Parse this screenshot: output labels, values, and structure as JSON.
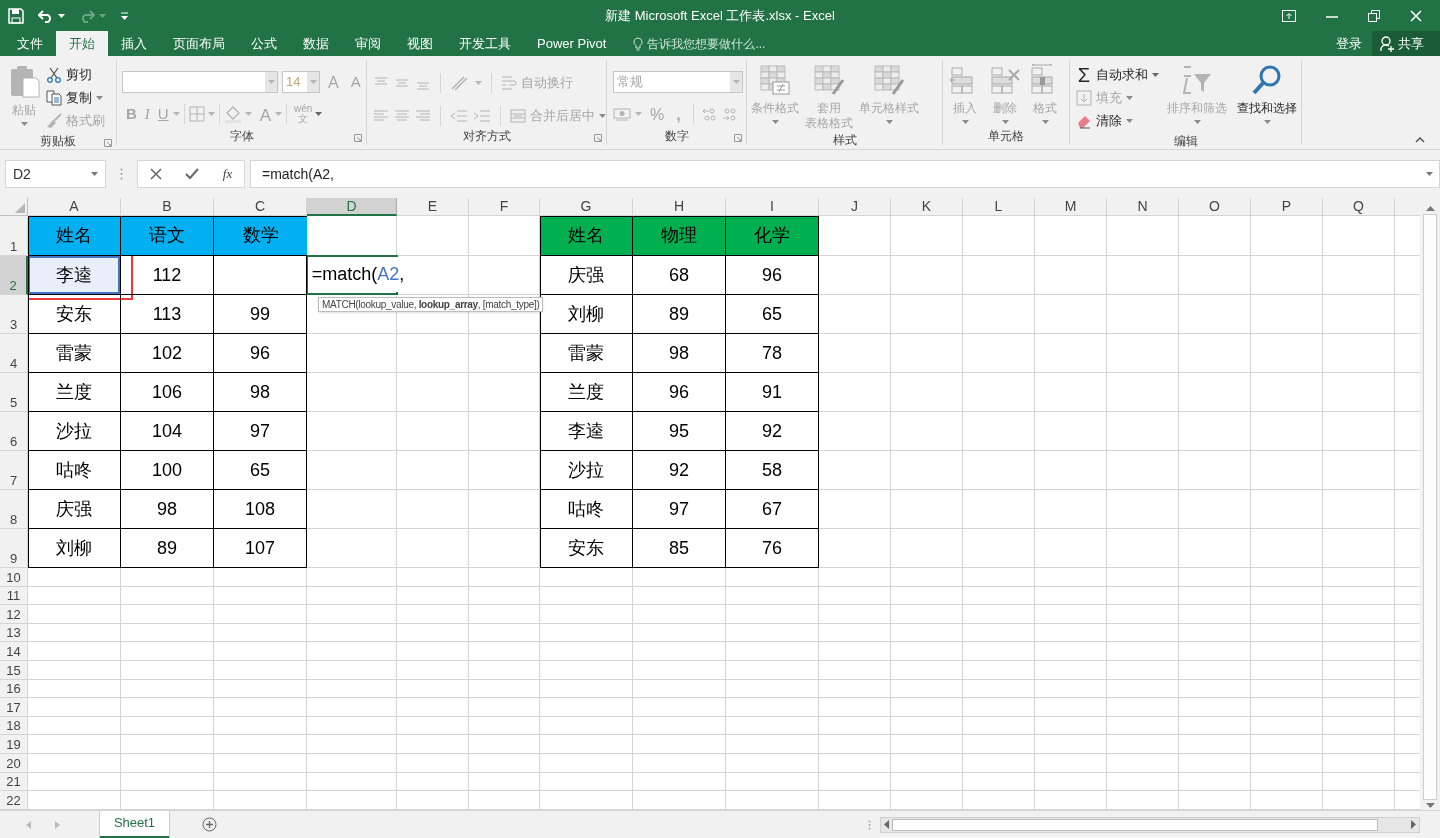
{
  "title_bar": {
    "title": "新建 Microsoft Excel 工作表.xlsx - Excel",
    "redo_disabled": true
  },
  "tabs": [
    {
      "label": "文件",
      "selected": false
    },
    {
      "label": "开始",
      "selected": true
    },
    {
      "label": "插入",
      "selected": false
    },
    {
      "label": "页面布局",
      "selected": false
    },
    {
      "label": "公式",
      "selected": false
    },
    {
      "label": "数据",
      "selected": false
    },
    {
      "label": "审阅",
      "selected": false
    },
    {
      "label": "视图",
      "selected": false
    },
    {
      "label": "开发工具",
      "selected": false
    },
    {
      "label": "Power Pivot",
      "selected": false
    }
  ],
  "tell_me": {
    "placeholder": "告诉我您想要做什么..."
  },
  "account": {
    "sign_in": "登录",
    "share": "共享"
  },
  "ribbon": {
    "groups": [
      {
        "kind": "clipboard",
        "label": "剪贴板",
        "launcher": true,
        "items": [
          {
            "text": "粘贴",
            "disabled": true
          },
          {
            "text": "剪切",
            "disabled": false
          },
          {
            "text": "复制",
            "disabled": false
          },
          {
            "text": "格式刷",
            "disabled": true
          }
        ]
      },
      {
        "kind": "font",
        "label": "字体",
        "launcher": true,
        "font_size": "14",
        "items": [
          {
            "text": "A",
            "disabled": true
          },
          {
            "text": "A",
            "disabled": true
          },
          {
            "text": "B",
            "disabled": true
          },
          {
            "text": "I",
            "disabled": true
          },
          {
            "text": "U",
            "disabled": true
          },
          {
            "text": "A",
            "disabled": true
          }
        ],
        "phonetic": {
          "top": "wén",
          "bottom": "文",
          "disabled": true
        }
      },
      {
        "kind": "alignment",
        "label": "对齐方式",
        "launcher": true,
        "items": [
          {
            "text": "自动换行",
            "disabled": true
          },
          {
            "text": "合并后居中",
            "disabled": true
          }
        ]
      },
      {
        "kind": "number",
        "label": "数字",
        "launcher": true,
        "format": "常规",
        "items": [
          {
            "text": "%",
            "disabled": true
          },
          {
            "text": ",",
            "disabled": true
          }
        ]
      },
      {
        "kind": "styles",
        "label": "样式",
        "launcher": false,
        "items": [
          {
            "text": "条件格式",
            "disabled": true
          },
          {
            "lines": [
              "套用",
              "表格格式"
            ],
            "disabled": true
          },
          {
            "text": "单元格样式",
            "disabled": true
          }
        ]
      },
      {
        "kind": "cells",
        "label": "单元格",
        "launcher": false,
        "items": [
          {
            "text": "插入",
            "disabled": true
          },
          {
            "text": "删除",
            "disabled": true
          },
          {
            "text": "格式",
            "disabled": true
          }
        ]
      },
      {
        "kind": "editing",
        "label": "编辑",
        "launcher": false,
        "items": [
          {
            "text": "自动求和",
            "symbol": "Σ",
            "disabled": false
          },
          {
            "text": "填充",
            "disabled": true
          },
          {
            "text": "清除",
            "disabled": false
          },
          {
            "text": "排序和筛选",
            "disabled": true
          },
          {
            "text": "查找和选择",
            "disabled": false
          }
        ]
      }
    ]
  },
  "formula_bar": {
    "name_box": "D2",
    "function_label": "fx",
    "formula": "=match(A2,"
  },
  "sheet": {
    "columns": [
      {
        "label": "A",
        "selected": false
      },
      {
        "label": "B",
        "selected": false
      },
      {
        "label": "C",
        "selected": false
      },
      {
        "label": "D",
        "selected": true
      },
      {
        "label": "E",
        "selected": false
      },
      {
        "label": "F",
        "selected": false
      },
      {
        "label": "G",
        "selected": false
      },
      {
        "label": "H",
        "selected": false
      },
      {
        "label": "I",
        "selected": false
      },
      {
        "label": "J",
        "selected": false
      },
      {
        "label": "K",
        "selected": false
      },
      {
        "label": "L",
        "selected": false
      },
      {
        "label": "M",
        "selected": false
      },
      {
        "label": "N",
        "selected": false
      },
      {
        "label": "O",
        "selected": false
      },
      {
        "label": "P",
        "selected": false
      },
      {
        "label": "Q",
        "selected": false
      }
    ],
    "rows": [
      {
        "label": "1",
        "selected": false
      },
      {
        "label": "2",
        "selected": true
      },
      {
        "label": "3",
        "selected": false
      },
      {
        "label": "4",
        "selected": false
      },
      {
        "label": "5",
        "selected": false
      },
      {
        "label": "6",
        "selected": false
      },
      {
        "label": "7",
        "selected": false
      },
      {
        "label": "8",
        "selected": false
      },
      {
        "label": "9",
        "selected": false
      },
      {
        "label": "10",
        "selected": false
      },
      {
        "label": "11",
        "selected": false
      },
      {
        "label": "12",
        "selected": false
      },
      {
        "label": "13",
        "selected": false
      },
      {
        "label": "14",
        "selected": false
      },
      {
        "label": "15",
        "selected": false
      },
      {
        "label": "16",
        "selected": false
      },
      {
        "label": "17",
        "selected": false
      },
      {
        "label": "18",
        "selected": false
      },
      {
        "label": "19",
        "selected": false
      },
      {
        "label": "20",
        "selected": false
      },
      {
        "label": "21",
        "selected": false
      },
      {
        "label": "22",
        "selected": false
      }
    ],
    "tables": [
      {
        "color": "#00b0f0",
        "columns": [
          "姓名",
          "语文",
          "数学"
        ],
        "rows": [
          {
            "cells": [
              "李逵",
              "112"
            ],
            "name_referenced": true
          },
          {
            "cells": [
              "安东",
              "113",
              "99"
            ],
            "name_referenced": false
          },
          {
            "cells": [
              "雷蒙",
              "102",
              "96"
            ],
            "name_referenced": false
          },
          {
            "cells": [
              "兰度",
              "106",
              "98"
            ],
            "name_referenced": false
          },
          {
            "cells": [
              "沙拉",
              "104",
              "97"
            ],
            "name_referenced": false
          },
          {
            "cells": [
              "咕咚",
              "100",
              "65"
            ],
            "name_referenced": false
          },
          {
            "cells": [
              "庆强",
              "98",
              "108"
            ],
            "name_referenced": false
          },
          {
            "cells": [
              "刘柳",
              "89",
              "107"
            ],
            "name_referenced": false
          }
        ]
      },
      {
        "color": "#00b050",
        "columns": [
          "姓名",
          "物理",
          "化学"
        ],
        "rows": [
          {
            "cells": [
              "庆强",
              "68",
              "96"
            ],
            "name_referenced": false
          },
          {
            "cells": [
              "刘柳",
              "89",
              "65"
            ],
            "name_referenced": false
          },
          {
            "cells": [
              "雷蒙",
              "98",
              "78"
            ],
            "name_referenced": false
          },
          {
            "cells": [
              "兰度",
              "96",
              "91"
            ],
            "name_referenced": false
          },
          {
            "cells": [
              "李逵",
              "95",
              "92"
            ],
            "name_referenced": false
          },
          {
            "cells": [
              "沙拉",
              "92",
              "58"
            ],
            "name_referenced": false
          },
          {
            "cells": [
              "咕咚",
              "97",
              "67"
            ],
            "name_referenced": false
          },
          {
            "cells": [
              "安东",
              "85",
              "76"
            ],
            "name_referenced": false
          }
        ]
      }
    ],
    "edit_text": [
      {
        "kind": "plain",
        "text": "=match("
      },
      {
        "kind": "reference",
        "text": "A2"
      },
      {
        "kind": "plain",
        "text": ","
      }
    ],
    "tooltip": "MATCH(lookup_value, **lookup_array**, [match_type])"
  },
  "sheet_tabs": [
    {
      "label": "Sheet1",
      "selected": true
    }
  ]
}
